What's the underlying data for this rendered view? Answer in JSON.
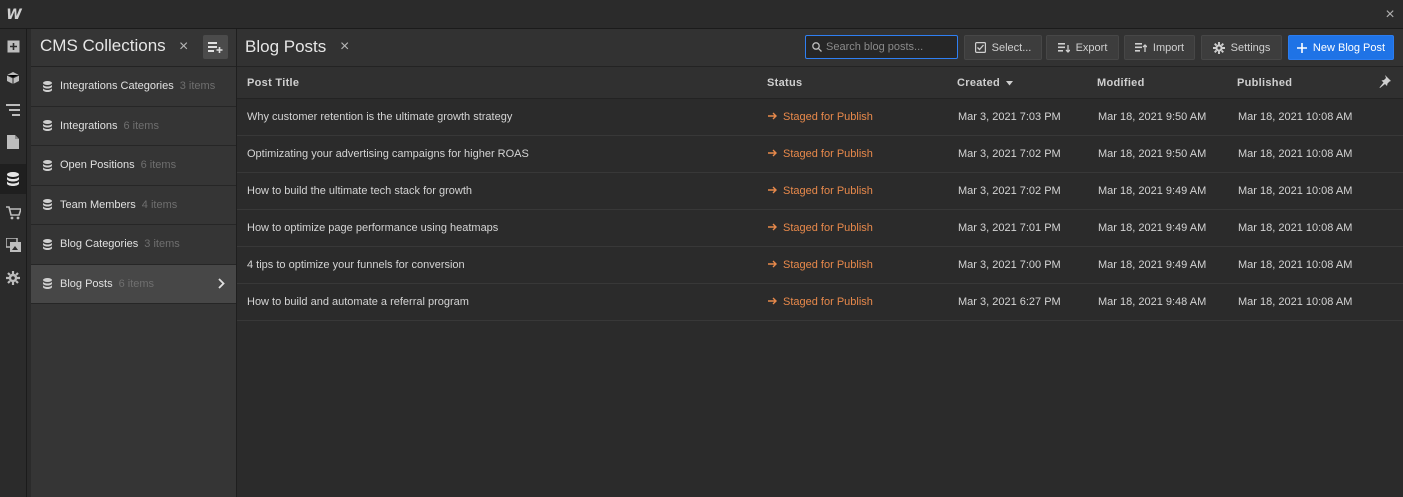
{
  "app": {
    "logo": "W",
    "close_glyph": "×"
  },
  "rail": {
    "icons": [
      "add-panel-icon",
      "box-icon",
      "navigator-icon",
      "pages-icon",
      "cms-icon",
      "ecommerce-icon",
      "assets-icon",
      "settings-icon"
    ]
  },
  "collections": {
    "title": "CMS Collections",
    "close_glyph": "×",
    "items": [
      {
        "label": "Integrations Categories",
        "count": "3 items"
      },
      {
        "label": "Integrations",
        "count": "6 items"
      },
      {
        "label": "Open Positions",
        "count": "6 items"
      },
      {
        "label": "Team Members",
        "count": "4 items"
      },
      {
        "label": "Blog Categories",
        "count": "3 items"
      },
      {
        "label": "Blog Posts",
        "count": "6 items",
        "selected": true
      }
    ],
    "chevron": "›"
  },
  "main": {
    "title": "Blog Posts",
    "close_glyph": "×",
    "search_placeholder": "Search blog posts...",
    "search_value": "",
    "buttons": {
      "select": "Select...",
      "export": "Export",
      "import": "Import",
      "settings": "Settings",
      "new": "New Blog Post"
    },
    "columns": {
      "title": "Post Title",
      "status": "Status",
      "created": "Created",
      "modified": "Modified",
      "published": "Published"
    },
    "rows": [
      {
        "title": "Why customer retention is the ultimate growth strategy",
        "status": "Staged for Publish",
        "created": "Mar 3, 2021 7:03 PM",
        "modified": "Mar 18, 2021 9:50 AM",
        "published": "Mar 18, 2021 10:08 AM"
      },
      {
        "title": "Optimizating your advertising campaigns for higher ROAS",
        "status": "Staged for Publish",
        "created": "Mar 3, 2021 7:02 PM",
        "modified": "Mar 18, 2021 9:50 AM",
        "published": "Mar 18, 2021 10:08 AM"
      },
      {
        "title": "How to build the ultimate tech stack for growth",
        "status": "Staged for Publish",
        "created": "Mar 3, 2021 7:02 PM",
        "modified": "Mar 18, 2021 9:49 AM",
        "published": "Mar 18, 2021 10:08 AM"
      },
      {
        "title": "How to optimize page performance using heatmaps",
        "status": "Staged for Publish",
        "created": "Mar 3, 2021 7:01 PM",
        "modified": "Mar 18, 2021 9:49 AM",
        "published": "Mar 18, 2021 10:08 AM"
      },
      {
        "title": "4 tips to optimize your funnels for conversion",
        "status": "Staged for Publish",
        "created": "Mar 3, 2021 7:00 PM",
        "modified": "Mar 18, 2021 9:49 AM",
        "published": "Mar 18, 2021 10:08 AM"
      },
      {
        "title": "How to build and automate a referral program",
        "status": "Staged for Publish",
        "created": "Mar 3, 2021 6:27 PM",
        "modified": "Mar 18, 2021 9:48 AM",
        "published": "Mar 18, 2021 10:08 AM"
      }
    ]
  },
  "colors": {
    "accent": "#1f73e6",
    "status": "#e8894b",
    "background": "#2b2b2b"
  }
}
